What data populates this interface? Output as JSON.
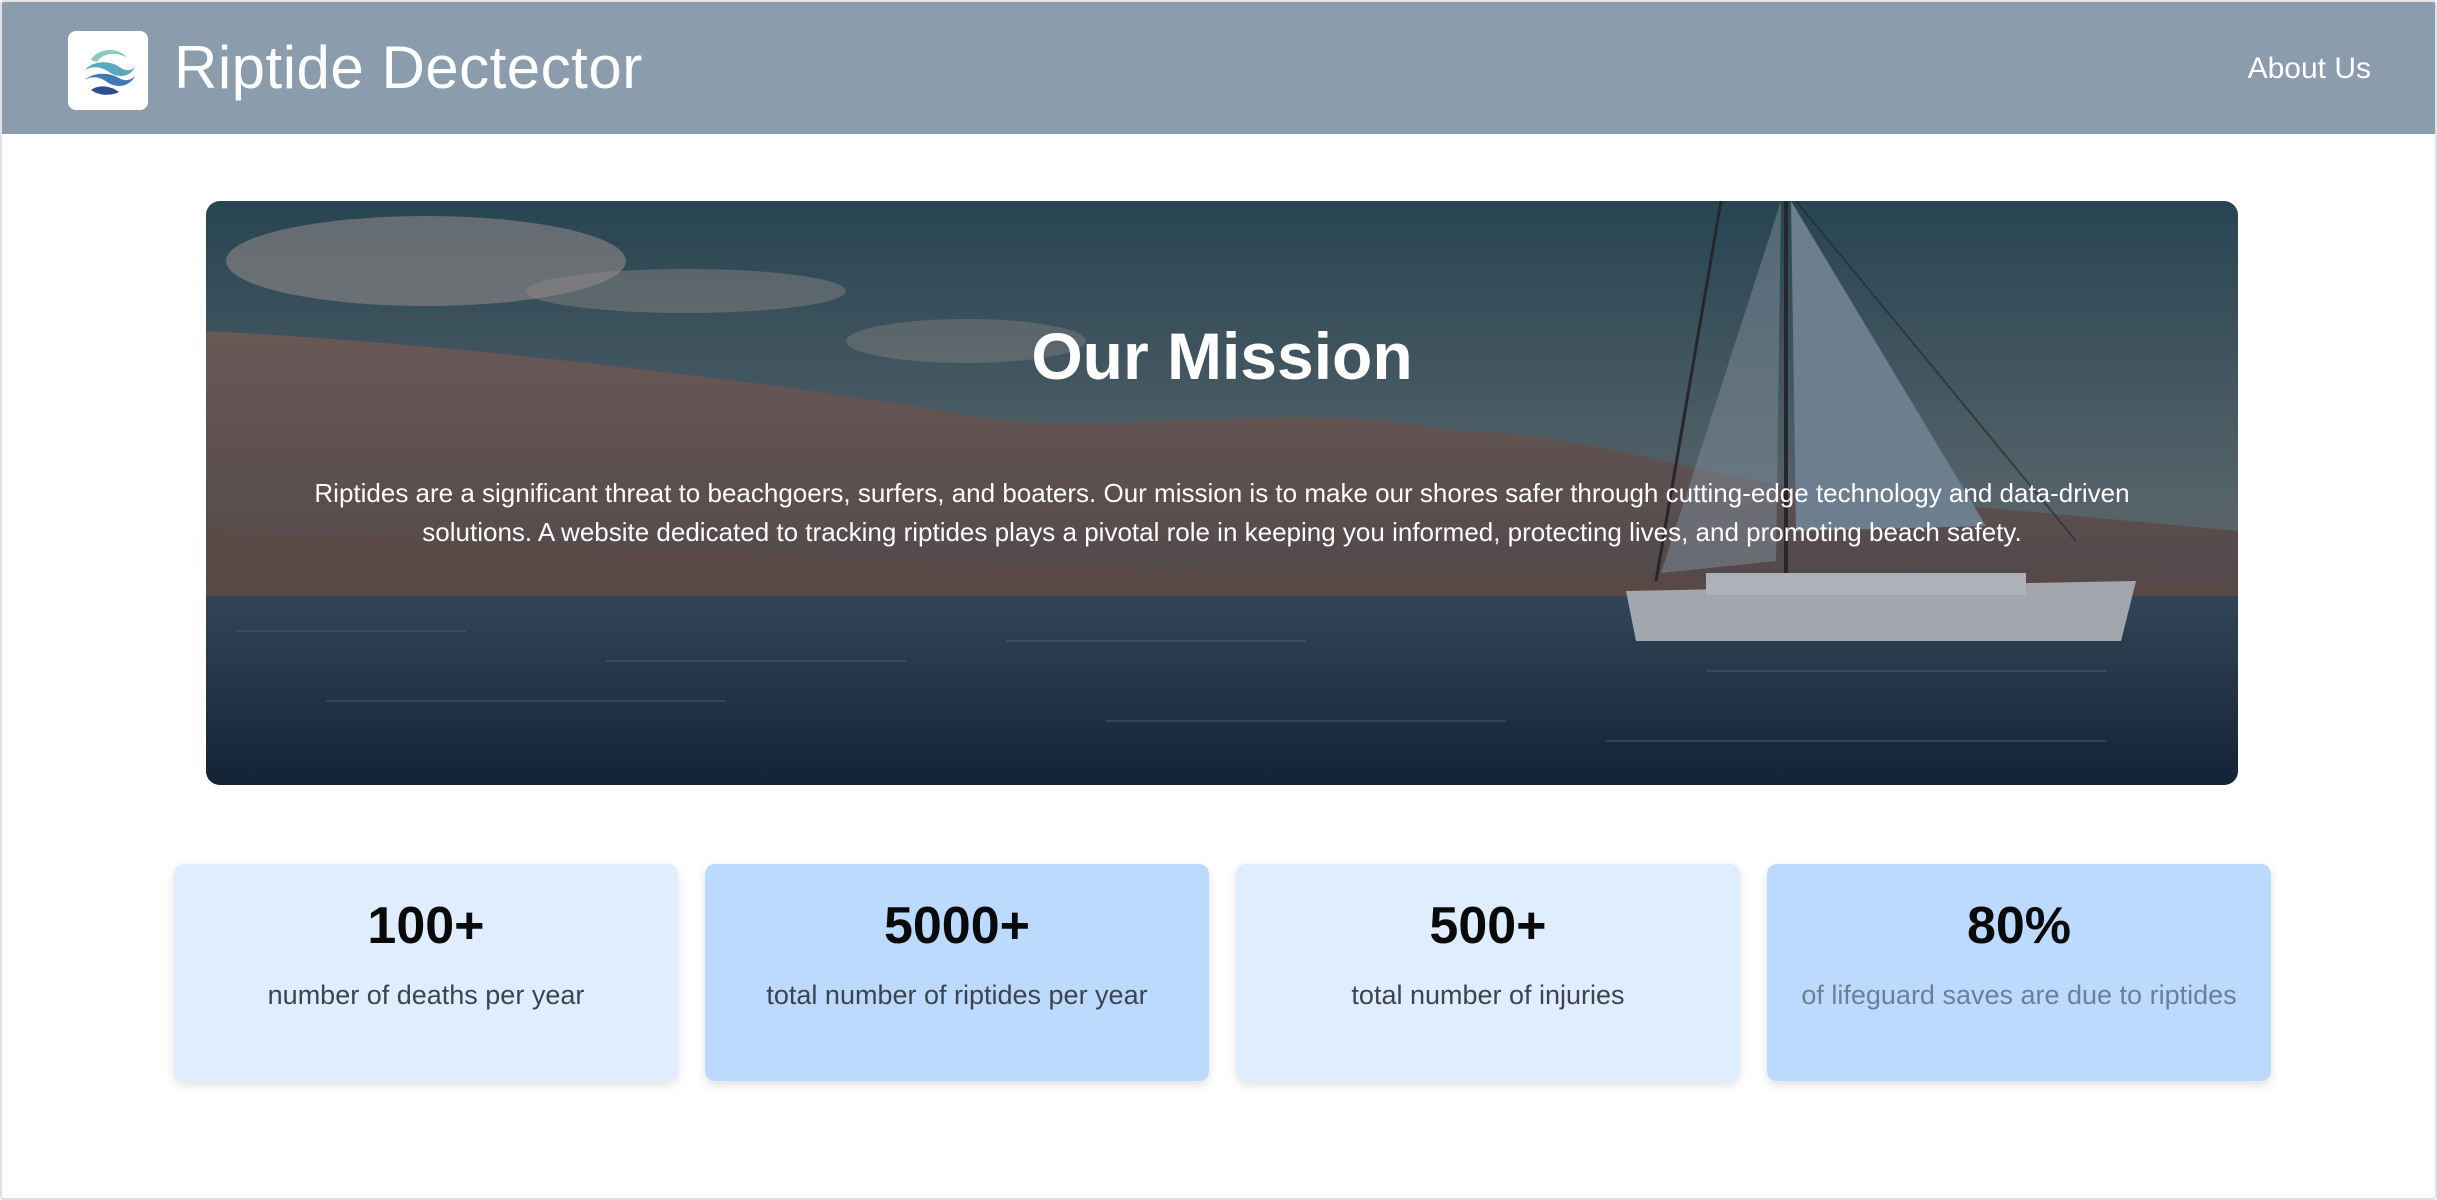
{
  "header": {
    "brand": "Riptide Dectector",
    "nav": {
      "about": "About Us"
    }
  },
  "hero": {
    "title": "Our Mission",
    "text": "Riptides are a significant threat to beachgoers, surfers, and boaters. Our mission is to make our shores safer through cutting-edge technology and data-driven solutions. A website dedicated to tracking riptides plays a pivotal role in keeping you informed, protecting lives, and promoting beach safety."
  },
  "stats": [
    {
      "value": "100+",
      "label": "number of deaths per year"
    },
    {
      "value": "5000+",
      "label": "total number of riptides per year"
    },
    {
      "value": "500+",
      "label": "total number of injuries"
    },
    {
      "value": "80%",
      "label": "of lifeguard saves are due to riptides"
    }
  ],
  "colors": {
    "navbar": "#8b9cad",
    "card_light": "#e0edfe",
    "card_blue": "#bcdafd"
  }
}
